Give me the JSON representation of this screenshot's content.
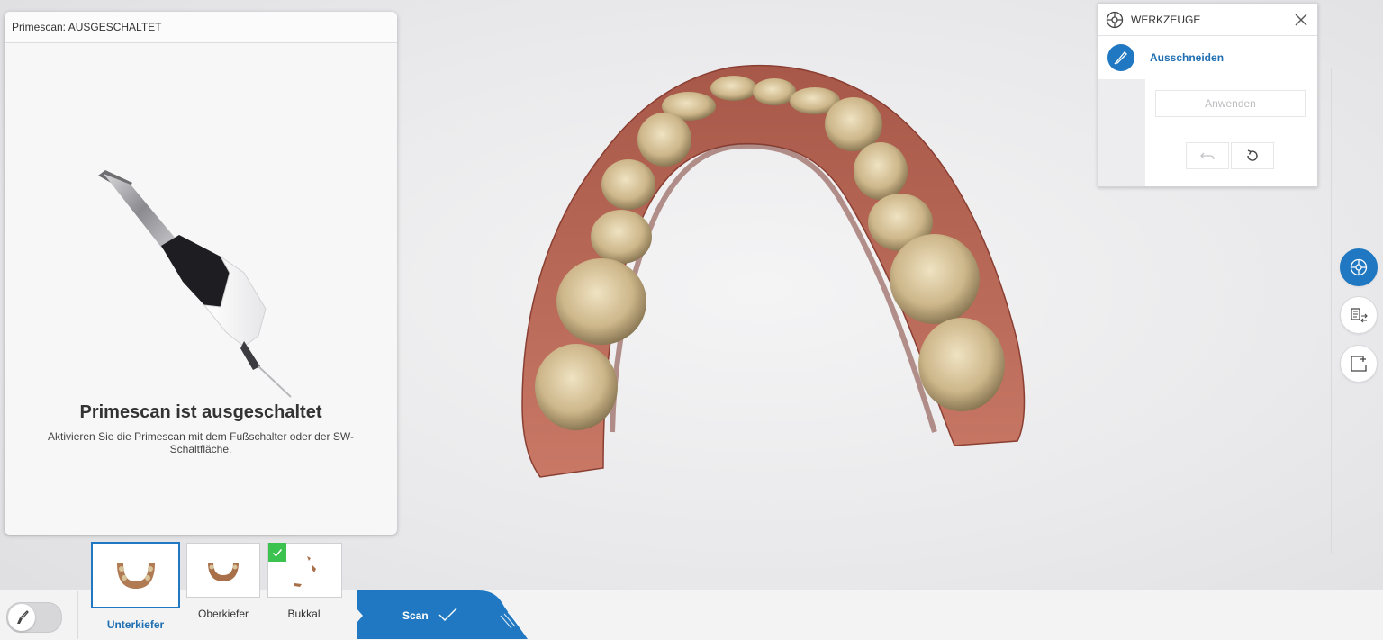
{
  "scanner_panel": {
    "header": "Primescan: AUSGESCHALTET",
    "status_title": "Primescan ist ausgeschaltet",
    "status_description": "Aktivieren Sie die Primescan mit dem Fußschalter oder der SW-Schaltfläche."
  },
  "tools_panel": {
    "title": "WERKZEUGE",
    "tool_label": "Ausschneiden",
    "apply_label": "Anwenden",
    "icons": [
      "tools-icon",
      "close-icon",
      "scalpel-icon",
      "undo-icon",
      "reset-icon"
    ]
  },
  "right_toolbar": {
    "buttons": [
      "tools-icon",
      "model-edit-icon",
      "add-region-icon"
    ],
    "active_button": "tools-icon"
  },
  "scan_catalog": {
    "items": [
      {
        "label": "Unterkiefer",
        "selected": true,
        "completed": false
      },
      {
        "label": "Oberkiefer",
        "selected": false,
        "completed": false
      },
      {
        "label": "Bukkal",
        "selected": false,
        "completed": true
      }
    ]
  },
  "scan_button": {
    "label": "Scan",
    "icon": "checkmark-icon"
  },
  "colors": {
    "accent": "#1f78c1",
    "check": "#3cc24e",
    "gingiva": "#b8624f",
    "tooth": "#cdb68a"
  }
}
